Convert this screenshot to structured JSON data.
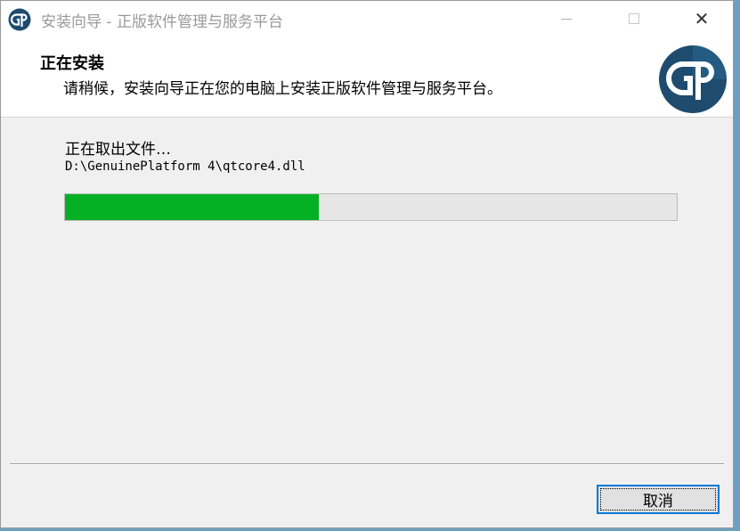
{
  "window": {
    "title": "安装向导 - 正版软件管理与服务平台",
    "app_icon": "gp-logo-icon",
    "controls": {
      "minimize_icon": "minimize-icon",
      "maximize_icon": "maximize-icon",
      "close_icon": "close-icon",
      "close_glyph": "✕"
    }
  },
  "header": {
    "title": "正在安装",
    "subtitle": "请稍候，安装向导正在您的电脑上安装正版软件管理与服务平台。",
    "logo_text": "GP"
  },
  "main": {
    "status": "正在取出文件…",
    "path": "D:\\GenuinePlatform 4\\qtcore4.dll",
    "progress": 0.415
  },
  "footer": {
    "cancel_label": "取消"
  },
  "colors": {
    "progress_fill": "#06b025",
    "logo_bg": "#1e4b6e",
    "focus_border": "#0078d7"
  }
}
